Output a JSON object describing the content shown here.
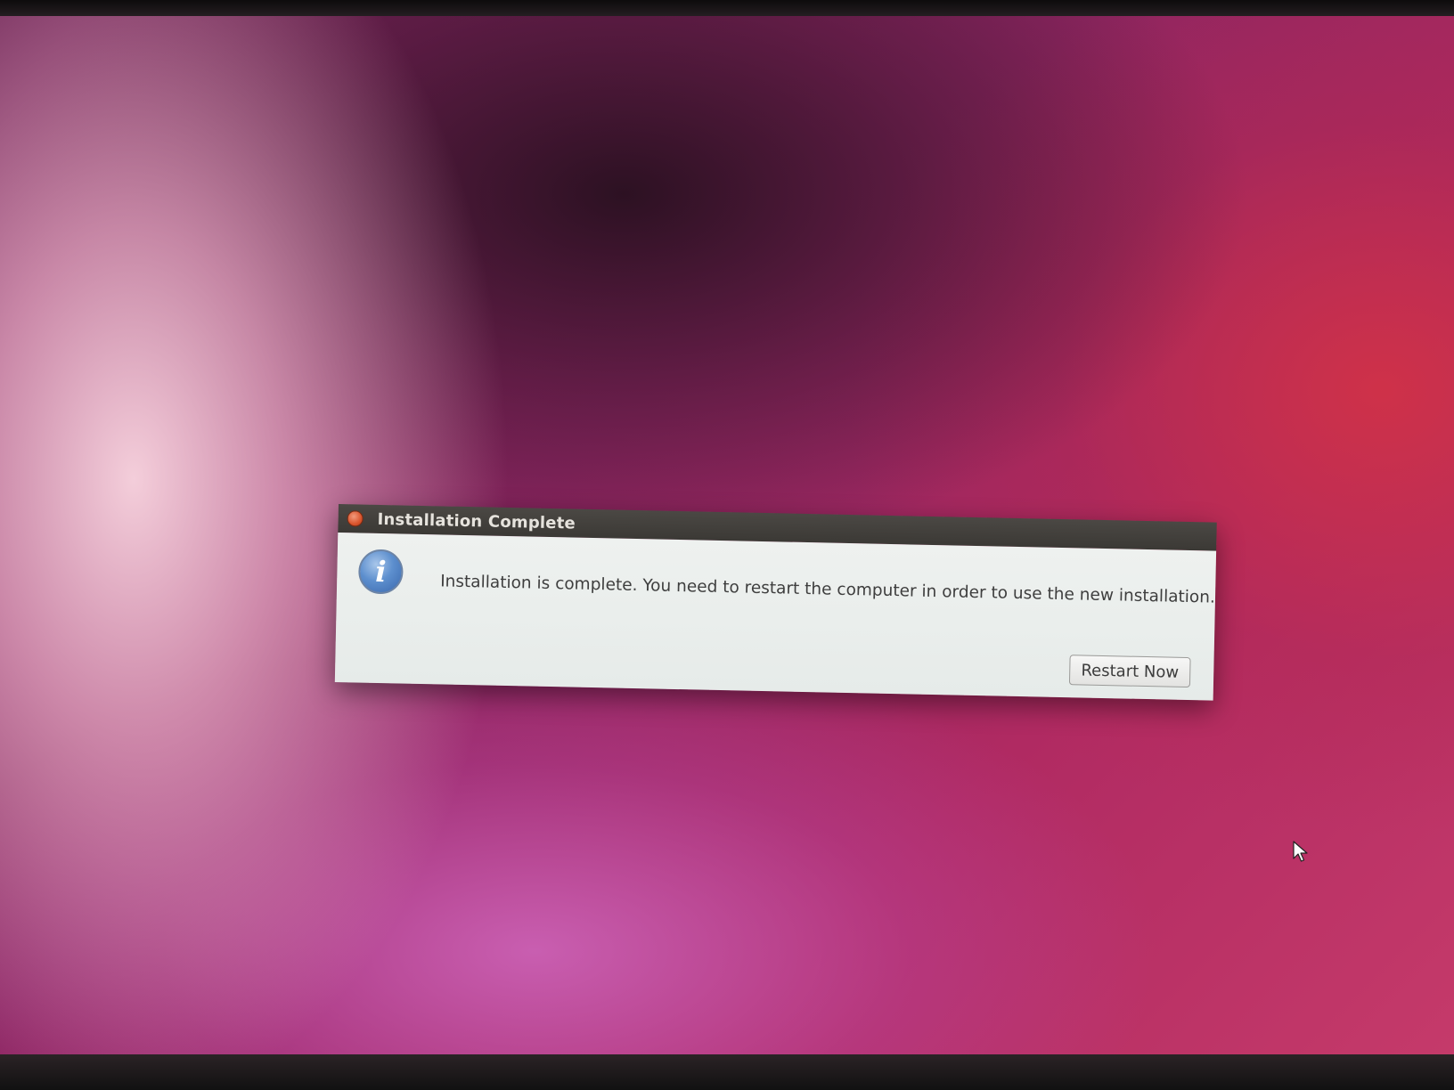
{
  "dialog": {
    "title": "Installation Complete",
    "message": "Installation is complete. You need to restart the computer in order to use the new installation.",
    "restart_button_label": "Restart Now",
    "icon": "info-icon",
    "info_glyph": "i"
  },
  "window_controls": {
    "close_icon": "close-icon",
    "close_color": "#d9542c"
  },
  "pointer": {
    "icon": "mouse-pointer-icon"
  },
  "colors": {
    "titlebar": "#3b3935",
    "dialog_body": "#eef1ef",
    "desktop_accent": "#b02a62"
  }
}
